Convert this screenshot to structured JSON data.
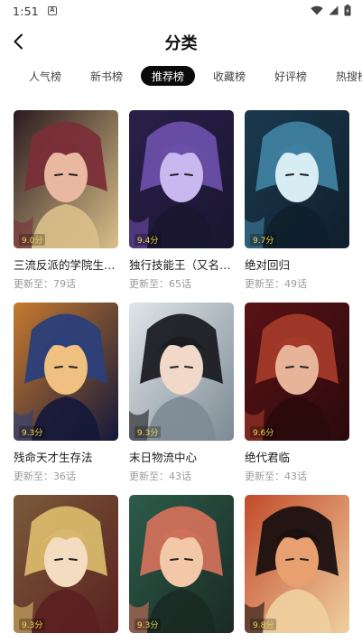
{
  "status": {
    "time": "1:51",
    "notification_glyph": "A"
  },
  "header": {
    "title": "分类",
    "back_icon": "chevron-left-icon"
  },
  "tabs": [
    {
      "label": "人气榜",
      "active": false
    },
    {
      "label": "新书榜",
      "active": false
    },
    {
      "label": "推荐榜",
      "active": true
    },
    {
      "label": "收藏榜",
      "active": false
    },
    {
      "label": "好评榜",
      "active": false
    },
    {
      "label": "热搜榜",
      "active": false
    }
  ],
  "comics": [
    {
      "title": "三流反派的学院生…",
      "update": "更新至：79话",
      "score": "9.0分",
      "palette": [
        "#2a1a1e",
        "#7a2e38",
        "#e8b9a0",
        "#d9c08a"
      ]
    },
    {
      "title": "独行技能王（又名…",
      "update": "更新至：65话",
      "score": "9.4分",
      "palette": [
        "#2a1f4a",
        "#6a4fa8",
        "#c9b8f0",
        "#1a1630"
      ]
    },
    {
      "title": "绝对回归",
      "update": "更新至：49话",
      "score": "9.7分",
      "palette": [
        "#1b3a4f",
        "#3f7fa0",
        "#d7ecf3",
        "#0f1f2c"
      ]
    },
    {
      "title": "残命天才生存法",
      "update": "更新至：36话",
      "score": "9.3分",
      "palette": [
        "#c77a2e",
        "#2b3f7a",
        "#f0c080",
        "#13183a"
      ]
    },
    {
      "title": "末日物流中心",
      "update": "更新至：43话",
      "score": "9.3分",
      "palette": [
        "#dfe6ea",
        "#1a1c22",
        "#f1d8c8",
        "#7d8a94"
      ]
    },
    {
      "title": "绝代君临",
      "update": "更新至：43话",
      "score": "9.6分",
      "palette": [
        "#5a1216",
        "#a33a2a",
        "#e7b49a",
        "#2a0a0c"
      ]
    },
    {
      "title": "",
      "update": "",
      "score": "9.3分",
      "palette": [
        "#7a5a3a",
        "#d8b86a",
        "#f3dcc0",
        "#5a2020"
      ]
    },
    {
      "title": "",
      "update": "",
      "score": "9.3分",
      "palette": [
        "#2c5c4a",
        "#d0705a",
        "#f2c8a8",
        "#1a2a24"
      ]
    },
    {
      "title": "",
      "update": "",
      "score": "9.8分",
      "palette": [
        "#c24a2a",
        "#1a1010",
        "#e8a070",
        "#f0d0a0"
      ]
    }
  ]
}
